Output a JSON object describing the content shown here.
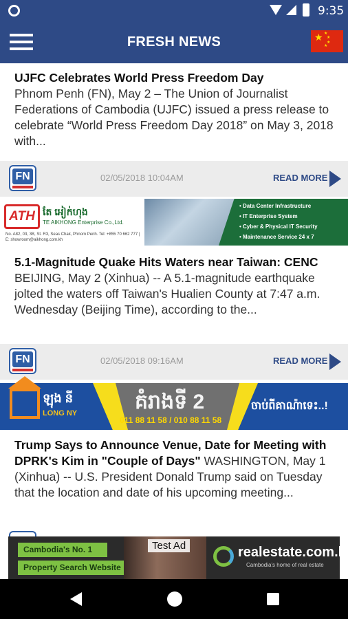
{
  "status_bar": {
    "time": "9:35"
  },
  "app_bar": {
    "title": "FRESH NEWS"
  },
  "articles": [
    {
      "headline": "UJFC Celebrates World Press Freedom Day",
      "summary": "Phnom Penh (FN), May 2 – The Union of Journalist Federations of Cambodia (UJFC) issued a press release to celebrate “World Press Freedom Day 2018” on May 3, 2018 with...",
      "date": "02/05/2018 10:04AM",
      "read_more": "READ MORE"
    },
    {
      "headline": "5.1-Magnitude Quake Hits Waters near Taiwan: CENC",
      "summary": "BEIJING, May 2 (Xinhua) -- A 5.1-magnitude earthquake jolted the waters off Taiwan's Hualien County at 7:47 a.m. Wednesday (Beijing Time), according to the...",
      "date": "02/05/2018 09:16AM",
      "read_more": "READ MORE"
    },
    {
      "headline": "Trump Says to Announce Venue, Date for Meeting with DPRK's Kim in \"Couple of Days\"",
      "summary": "WASHINGTON, May 1 (Xinhua) -- U.S. President Donald Trump said on Tuesday that the location and date of his upcoming meeting..."
    }
  ],
  "fn_logo_text": "FN",
  "ad_banner_1": {
    "logo": "ATH",
    "brand_kh": "តែ អៀក់ហុង",
    "brand_en": "TE AIKHONG Enterprise Co.,Ltd.",
    "address": "No. A82, 03, 3B, St. R3, Seas Chak, Phnom Penh. Tel: +855 70 662 777 | E: showroom@aikhong.com.kh",
    "services": [
      "• Data Center Infrastructure",
      "• IT Enterprise System",
      "• Cyber & Physical IT Security",
      "• Maintenance Service 24 x 7"
    ]
  },
  "ad_banner_2": {
    "brand_kh": "ឡុង នី",
    "brand_en": "LONG NY",
    "floor": "គំរាងទី 2",
    "phones": "011 88 11 58 / 010 88 11 58",
    "cta": "ចាប់ពីគាណ៉ាទេះ..!"
  },
  "bottom_ad": {
    "tag1": "Cambodia's No. 1",
    "tag2": "Property Search Website",
    "label": "Test Ad",
    "brand": "realestate.com.kh",
    "tagline": "Cambodia's home of real estate"
  },
  "colors": {
    "primary": "#2e4a86",
    "meta_bg": "#ececec",
    "accent_red": "#de2910"
  },
  "icons": {
    "menu": "hamburger-icon",
    "flag": "china-flag-icon",
    "read_more": "chevron-right-icon"
  }
}
